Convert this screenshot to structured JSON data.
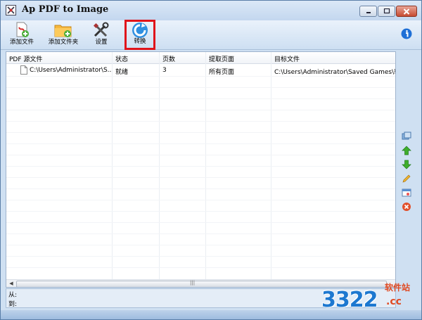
{
  "window": {
    "title": "Ap PDF to Image"
  },
  "toolbar": {
    "add_file": "添加文件",
    "add_folder": "添加文件夹",
    "settings": "设置",
    "convert": "转换"
  },
  "table": {
    "columns": [
      "PDF 源文件",
      "状态",
      "页数",
      "提取页面",
      "目标文件"
    ],
    "rows": [
      {
        "source": "C:\\Users\\Administrator\\S...",
        "status": "就绪",
        "pages": "3",
        "extract": "所有页面",
        "target": "C:\\Users\\Administrator\\Saved Games\\软件"
      }
    ]
  },
  "status": {
    "from_label": "从:",
    "to_label": "到:"
  },
  "watermark": {
    "number": "3322",
    "domain": ".cc",
    "site": "软件站"
  },
  "colors": {
    "accent_red": "#e0141b",
    "title_bar": "#c3d7ef",
    "watermark_blue": "#1d78d0",
    "watermark_orange": "#e04a22"
  },
  "icons": {
    "side": [
      "refresh-icon",
      "move-up-icon",
      "move-down-icon",
      "edit-icon",
      "view-icon",
      "remove-icon"
    ]
  }
}
